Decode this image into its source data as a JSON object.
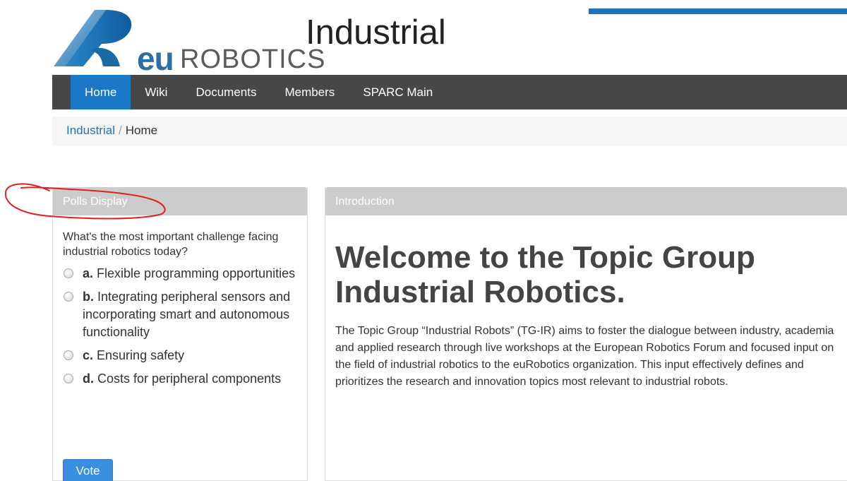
{
  "header": {
    "logo_eu": "eu",
    "logo_robotics": "ROBOTICS",
    "site_title": "Industrial",
    "colors": {
      "brand_blue": "#1b75bb",
      "nav_bg": "#474747",
      "nav_active": "#1b78c8"
    }
  },
  "nav": {
    "items": [
      {
        "label": "Home",
        "active": true
      },
      {
        "label": "Wiki",
        "active": false
      },
      {
        "label": "Documents",
        "active": false
      },
      {
        "label": "Members",
        "active": false
      },
      {
        "label": "SPARC Main",
        "active": false
      }
    ]
  },
  "breadcrumb": {
    "link": "Industrial",
    "separator": "/",
    "current": "Home"
  },
  "poll": {
    "heading": "Polls Display",
    "question": "What's the most important challenge facing industrial robotics today?",
    "options": [
      {
        "letter": "a.",
        "text": "Flexible programming opportunities"
      },
      {
        "letter": "b.",
        "text": "Integrating peripheral sensors and incorporating smart and autonomous functionality"
      },
      {
        "letter": "c.",
        "text": "Ensuring safety"
      },
      {
        "letter": "d.",
        "text": "Costs for peripheral components"
      }
    ],
    "vote_label": "Vote"
  },
  "intro": {
    "heading": "Introduction",
    "welcome": "Welcome to the Topic Group Industrial Robotics.",
    "body": "The Topic Group “Industrial Robots” (TG-IR) aims to foster the dialogue between industry, academia and applied research through live workshops at the European Robotics Forum and focused input on the field of industrial robotics to the euRobotics organization. This input effectively defines and prioritizes the research and innovation topics most relevant to industrial robots."
  },
  "icons": {
    "logo": "eurobotics-logo-icon",
    "radio": "radio-icon"
  },
  "annotation": {
    "color": "#e0201a",
    "shape": "hand-drawn ellipse around Polls Display"
  }
}
